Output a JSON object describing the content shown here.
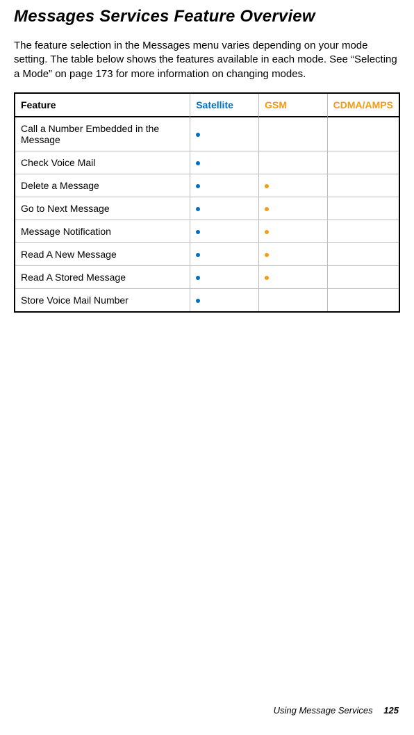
{
  "title": "Messages Services Feature Overview",
  "intro": "The feature selection in the Messages menu varies depending on your mode setting. The table below shows the features available in each mode. See “Selecting a Mode” on page 173 for more information on changing modes.",
  "table": {
    "headers": {
      "feature": "Feature",
      "satellite": "Satellite",
      "gsm": "GSM",
      "cdma": "CDMA/AMPS"
    },
    "rows": [
      {
        "feature": "Call a Number Embedded in the Message",
        "sat": true,
        "gsm": false,
        "cdma": false
      },
      {
        "feature": "Check Voice Mail",
        "sat": true,
        "gsm": false,
        "cdma": false
      },
      {
        "feature": "Delete a Message",
        "sat": true,
        "gsm": true,
        "cdma": false
      },
      {
        "feature": "Go to Next Message",
        "sat": true,
        "gsm": true,
        "cdma": false
      },
      {
        "feature": "Message Notification",
        "sat": true,
        "gsm": true,
        "cdma": false
      },
      {
        "feature": "Read A New Message",
        "sat": true,
        "gsm": true,
        "cdma": false
      },
      {
        "feature": "Read A Stored Message",
        "sat": true,
        "gsm": true,
        "cdma": false
      },
      {
        "feature": "Store Voice Mail Number",
        "sat": true,
        "gsm": false,
        "cdma": false
      }
    ]
  },
  "footer": {
    "section": "Using Message Services",
    "page": "125"
  },
  "colors": {
    "blue": "#0070c0",
    "orange": "#f39c12"
  },
  "chart_data": {
    "type": "table",
    "title": "Messages Services Feature Overview",
    "columns": [
      "Feature",
      "Satellite",
      "GSM",
      "CDMA/AMPS"
    ],
    "rows": [
      [
        "Call a Number Embedded in the Message",
        true,
        false,
        false
      ],
      [
        "Check Voice Mail",
        true,
        false,
        false
      ],
      [
        "Delete a Message",
        true,
        true,
        false
      ],
      [
        "Go to Next Message",
        true,
        true,
        false
      ],
      [
        "Message Notification",
        true,
        true,
        false
      ],
      [
        "Read A New Message",
        true,
        true,
        false
      ],
      [
        "Read A Stored Message",
        true,
        true,
        false
      ],
      [
        "Store Voice Mail Number",
        true,
        false,
        false
      ]
    ]
  }
}
